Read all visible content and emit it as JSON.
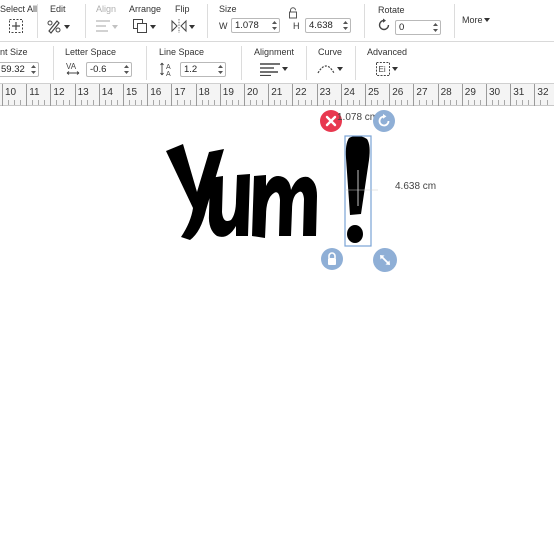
{
  "toolbar": {
    "select_all": "Select All",
    "edit": "Edit",
    "align": "Align",
    "arrange": "Arrange",
    "flip": "Flip",
    "size": "Size",
    "w_label": "W",
    "w_value": "1.078",
    "h_label": "H",
    "h_value": "4.638",
    "rotate": "Rotate",
    "rotate_value": "0",
    "more": "More"
  },
  "text_toolbar": {
    "font_size_label": "nt Size",
    "font_size_value": "59.32",
    "letter_space_label": "Letter Space",
    "letter_space_value": "-0.6",
    "line_space_label": "Line Space",
    "line_space_value": "1.2",
    "alignment_label": "Alignment",
    "curve_label": "Curve",
    "advanced_label": "Advanced"
  },
  "ruler": {
    "numbers": [
      "10",
      "11",
      "12",
      "13",
      "14",
      "15",
      "16",
      "17",
      "18",
      "19",
      "20",
      "21",
      "22",
      "23",
      "24",
      "25",
      "26",
      "27",
      "28",
      "29",
      "30",
      "31",
      "32"
    ]
  },
  "canvas": {
    "text_object": "Yum!",
    "width_readout": "1.078 cm",
    "height_readout": "4.638 cm"
  },
  "colors": {
    "accent_delete": "#e8384f",
    "handle_blue": "#8fafd6",
    "selection_border": "#7aa4d6"
  },
  "icons": {
    "delete": "close-icon",
    "rotate": "rotate-icon",
    "lock": "lock-icon",
    "scale": "resize-icon"
  }
}
